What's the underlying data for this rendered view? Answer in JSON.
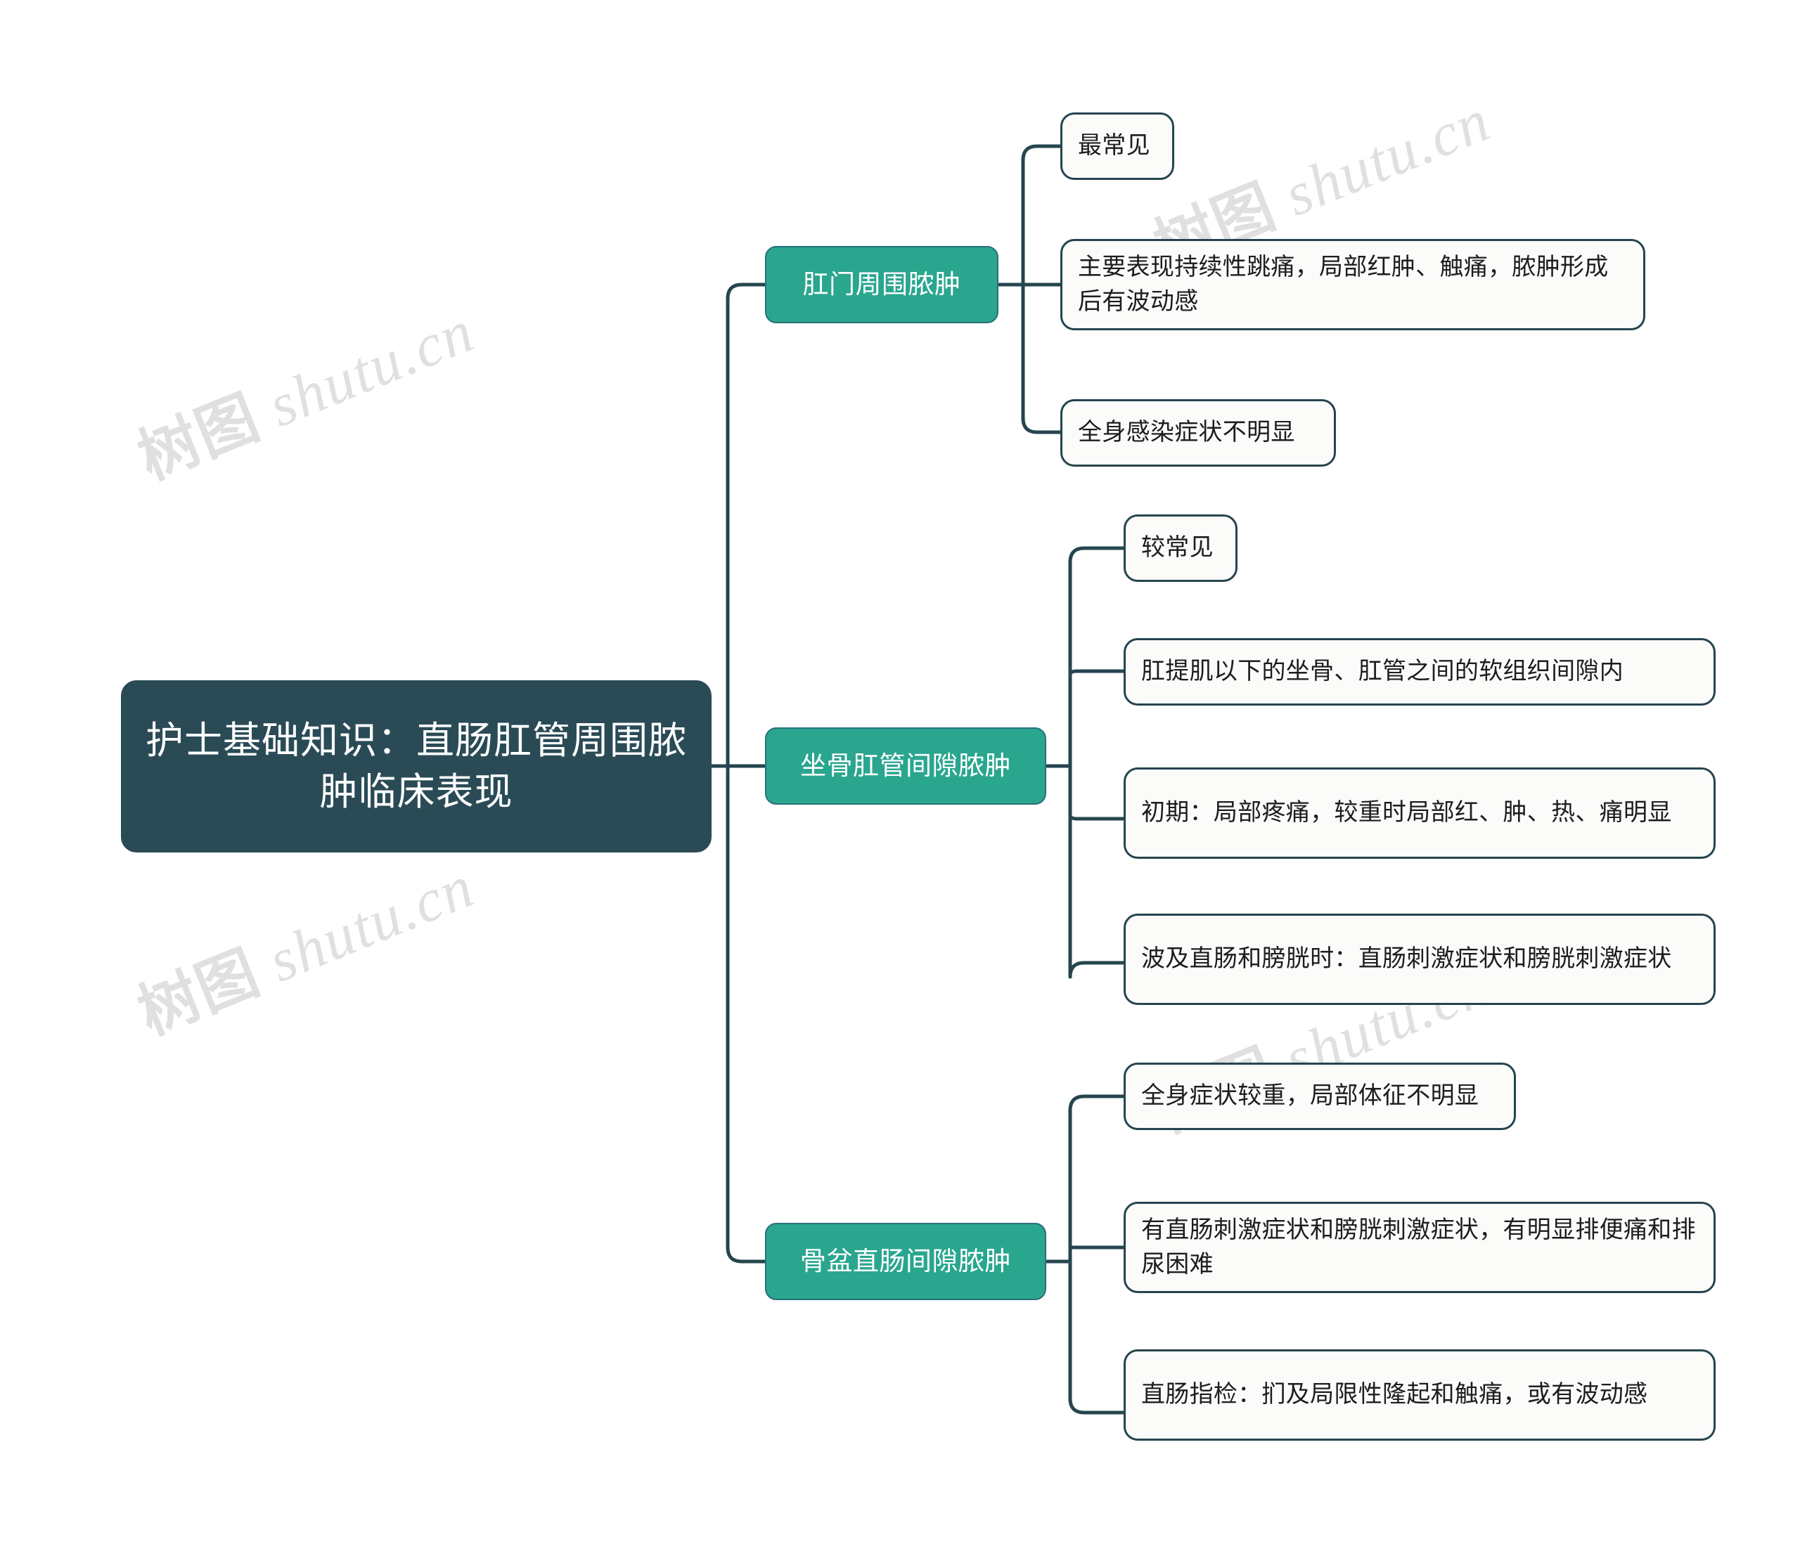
{
  "meta": {
    "background_color": "#ffffff",
    "root_color": "#2a4b56",
    "branch_color": "#2aa68f",
    "leaf_border_color": "#25454f",
    "leaf_fill_color": "#fbfbfa",
    "connector_color": "#25454f",
    "watermark_color": "#e0e0e0"
  },
  "watermark": {
    "cjk": "树图",
    "latin": " shutu.cn",
    "full": "树图 shutu.cn"
  },
  "root": {
    "label": "护士基础知识：直肠肛管周围脓肿临床表现"
  },
  "branches": [
    {
      "label": "肛门周围脓肿",
      "leaves": [
        {
          "label": "最常见"
        },
        {
          "label": "主要表现持续性跳痛，局部红肿、触痛，脓肿形成后有波动感"
        },
        {
          "label": "全身感染症状不明显"
        }
      ]
    },
    {
      "label": "坐骨肛管间隙脓肿",
      "leaves": [
        {
          "label": "较常见"
        },
        {
          "label": "肛提肌以下的坐骨、肛管之间的软组织间隙内"
        },
        {
          "label": "初期：局部疼痛，较重时局部红、肿、热、痛明显"
        },
        {
          "label": "波及直肠和膀胱时：直肠刺激症状和膀胱刺激症状"
        }
      ]
    },
    {
      "label": "骨盆直肠间隙脓肿",
      "leaves": [
        {
          "label": "全身症状较重，局部体征不明显"
        },
        {
          "label": "有直肠刺激症状和膀胱刺激症状，有明显排便痛和排尿困难"
        },
        {
          "label": "直肠指检：扪及局限性隆起和触痛，或有波动感"
        }
      ]
    }
  ]
}
